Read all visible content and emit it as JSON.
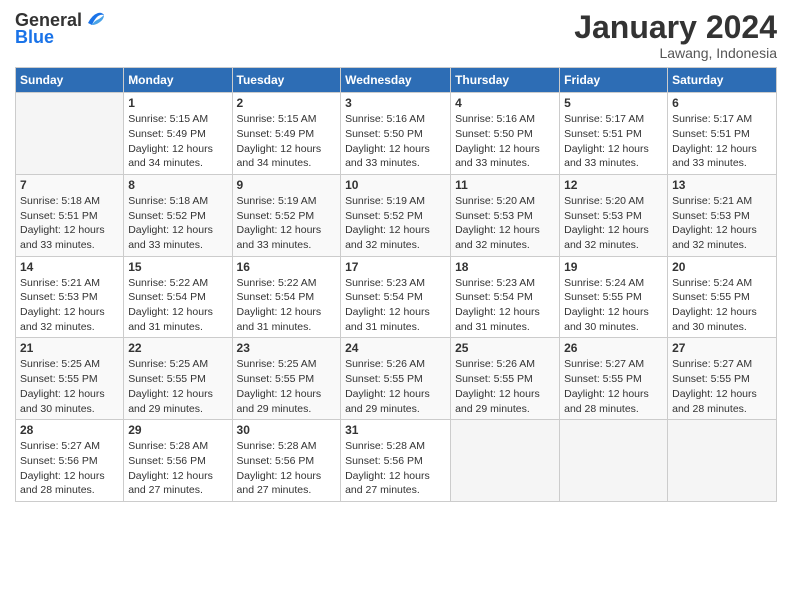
{
  "header": {
    "logo_line1": "General",
    "logo_line2": "Blue",
    "month_title": "January 2024",
    "location": "Lawang, Indonesia"
  },
  "weekdays": [
    "Sunday",
    "Monday",
    "Tuesday",
    "Wednesday",
    "Thursday",
    "Friday",
    "Saturday"
  ],
  "weeks": [
    [
      {
        "day": "",
        "info": ""
      },
      {
        "day": "1",
        "info": "Sunrise: 5:15 AM\nSunset: 5:49 PM\nDaylight: 12 hours\nand 34 minutes."
      },
      {
        "day": "2",
        "info": "Sunrise: 5:15 AM\nSunset: 5:49 PM\nDaylight: 12 hours\nand 34 minutes."
      },
      {
        "day": "3",
        "info": "Sunrise: 5:16 AM\nSunset: 5:50 PM\nDaylight: 12 hours\nand 33 minutes."
      },
      {
        "day": "4",
        "info": "Sunrise: 5:16 AM\nSunset: 5:50 PM\nDaylight: 12 hours\nand 33 minutes."
      },
      {
        "day": "5",
        "info": "Sunrise: 5:17 AM\nSunset: 5:51 PM\nDaylight: 12 hours\nand 33 minutes."
      },
      {
        "day": "6",
        "info": "Sunrise: 5:17 AM\nSunset: 5:51 PM\nDaylight: 12 hours\nand 33 minutes."
      }
    ],
    [
      {
        "day": "7",
        "info": "Sunrise: 5:18 AM\nSunset: 5:51 PM\nDaylight: 12 hours\nand 33 minutes."
      },
      {
        "day": "8",
        "info": "Sunrise: 5:18 AM\nSunset: 5:52 PM\nDaylight: 12 hours\nand 33 minutes."
      },
      {
        "day": "9",
        "info": "Sunrise: 5:19 AM\nSunset: 5:52 PM\nDaylight: 12 hours\nand 33 minutes."
      },
      {
        "day": "10",
        "info": "Sunrise: 5:19 AM\nSunset: 5:52 PM\nDaylight: 12 hours\nand 32 minutes."
      },
      {
        "day": "11",
        "info": "Sunrise: 5:20 AM\nSunset: 5:53 PM\nDaylight: 12 hours\nand 32 minutes."
      },
      {
        "day": "12",
        "info": "Sunrise: 5:20 AM\nSunset: 5:53 PM\nDaylight: 12 hours\nand 32 minutes."
      },
      {
        "day": "13",
        "info": "Sunrise: 5:21 AM\nSunset: 5:53 PM\nDaylight: 12 hours\nand 32 minutes."
      }
    ],
    [
      {
        "day": "14",
        "info": "Sunrise: 5:21 AM\nSunset: 5:53 PM\nDaylight: 12 hours\nand 32 minutes."
      },
      {
        "day": "15",
        "info": "Sunrise: 5:22 AM\nSunset: 5:54 PM\nDaylight: 12 hours\nand 31 minutes."
      },
      {
        "day": "16",
        "info": "Sunrise: 5:22 AM\nSunset: 5:54 PM\nDaylight: 12 hours\nand 31 minutes."
      },
      {
        "day": "17",
        "info": "Sunrise: 5:23 AM\nSunset: 5:54 PM\nDaylight: 12 hours\nand 31 minutes."
      },
      {
        "day": "18",
        "info": "Sunrise: 5:23 AM\nSunset: 5:54 PM\nDaylight: 12 hours\nand 31 minutes."
      },
      {
        "day": "19",
        "info": "Sunrise: 5:24 AM\nSunset: 5:55 PM\nDaylight: 12 hours\nand 30 minutes."
      },
      {
        "day": "20",
        "info": "Sunrise: 5:24 AM\nSunset: 5:55 PM\nDaylight: 12 hours\nand 30 minutes."
      }
    ],
    [
      {
        "day": "21",
        "info": "Sunrise: 5:25 AM\nSunset: 5:55 PM\nDaylight: 12 hours\nand 30 minutes."
      },
      {
        "day": "22",
        "info": "Sunrise: 5:25 AM\nSunset: 5:55 PM\nDaylight: 12 hours\nand 29 minutes."
      },
      {
        "day": "23",
        "info": "Sunrise: 5:25 AM\nSunset: 5:55 PM\nDaylight: 12 hours\nand 29 minutes."
      },
      {
        "day": "24",
        "info": "Sunrise: 5:26 AM\nSunset: 5:55 PM\nDaylight: 12 hours\nand 29 minutes."
      },
      {
        "day": "25",
        "info": "Sunrise: 5:26 AM\nSunset: 5:55 PM\nDaylight: 12 hours\nand 29 minutes."
      },
      {
        "day": "26",
        "info": "Sunrise: 5:27 AM\nSunset: 5:55 PM\nDaylight: 12 hours\nand 28 minutes."
      },
      {
        "day": "27",
        "info": "Sunrise: 5:27 AM\nSunset: 5:55 PM\nDaylight: 12 hours\nand 28 minutes."
      }
    ],
    [
      {
        "day": "28",
        "info": "Sunrise: 5:27 AM\nSunset: 5:56 PM\nDaylight: 12 hours\nand 28 minutes."
      },
      {
        "day": "29",
        "info": "Sunrise: 5:28 AM\nSunset: 5:56 PM\nDaylight: 12 hours\nand 27 minutes."
      },
      {
        "day": "30",
        "info": "Sunrise: 5:28 AM\nSunset: 5:56 PM\nDaylight: 12 hours\nand 27 minutes."
      },
      {
        "day": "31",
        "info": "Sunrise: 5:28 AM\nSunset: 5:56 PM\nDaylight: 12 hours\nand 27 minutes."
      },
      {
        "day": "",
        "info": ""
      },
      {
        "day": "",
        "info": ""
      },
      {
        "day": "",
        "info": ""
      }
    ]
  ]
}
